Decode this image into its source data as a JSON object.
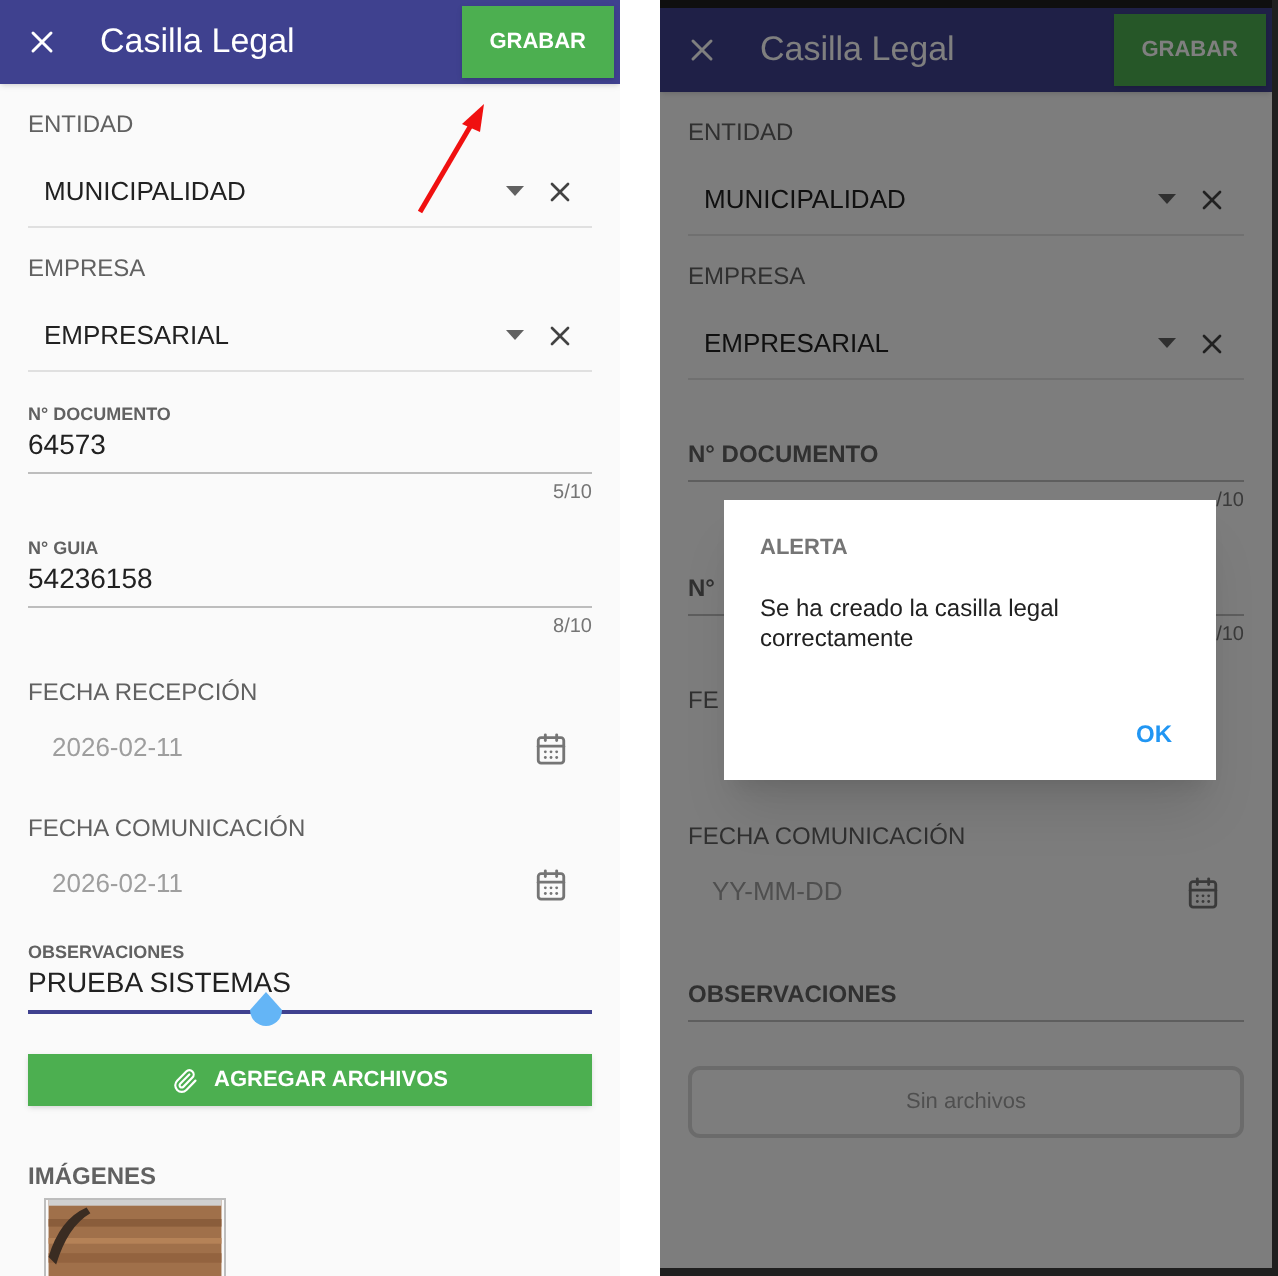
{
  "screens": [
    {
      "dimmed": false,
      "header": {
        "title": "Casilla Legal",
        "action": "GRABAR"
      },
      "fields": [
        {
          "kind": "select",
          "label": "ENTIDAD",
          "value": "MUNICIPALIDAD"
        },
        {
          "kind": "select",
          "label": "EMPRESA",
          "value": "EMPRESARIAL"
        },
        {
          "kind": "text",
          "label": "N° DOCUMENTO",
          "value": "64573",
          "counter": "5/10"
        },
        {
          "kind": "text",
          "label": "N° GUIA",
          "value": "54236158",
          "counter": "8/10"
        },
        {
          "kind": "date",
          "label": "FECHA RECEPCIÓN",
          "value": "2026-02-11"
        },
        {
          "kind": "date",
          "label": "FECHA COMUNICACIÓN",
          "value": "2026-02-11"
        },
        {
          "kind": "text",
          "label": "OBSERVACIONES",
          "value": "PRUEBA SISTEMAS",
          "focused": true
        }
      ],
      "attach": {
        "kind": "add",
        "label": "AGREGAR ARCHIVOS"
      },
      "images": {
        "label": "IMÁGENES"
      }
    },
    {
      "dimmed": true,
      "header": {
        "title": "Casilla Legal",
        "action": "GRABAR"
      },
      "fields": [
        {
          "kind": "select",
          "label": "ENTIDAD",
          "value": "MUNICIPALIDAD"
        },
        {
          "kind": "select",
          "label": "EMPRESA",
          "value": "EMPRESARIAL"
        },
        {
          "kind": "text",
          "label": "N° DOCUMENTO",
          "counter": "/10"
        },
        {
          "kind": "text",
          "label": "N°",
          "counter": "/10"
        },
        {
          "kind": "date",
          "label": "FE"
        },
        {
          "kind": "date",
          "label": "FECHA COMUNICACIÓN",
          "placeholder": "YY-MM-DD"
        },
        {
          "kind": "text",
          "label": "OBSERVACIONES",
          "focused": false
        }
      ],
      "attach": {
        "kind": "empty",
        "label": "Sin archivos"
      },
      "dialog": {
        "title": "ALERTA",
        "message": "Se ha creado la casilla legal correctamente",
        "button": "OK"
      }
    }
  ]
}
